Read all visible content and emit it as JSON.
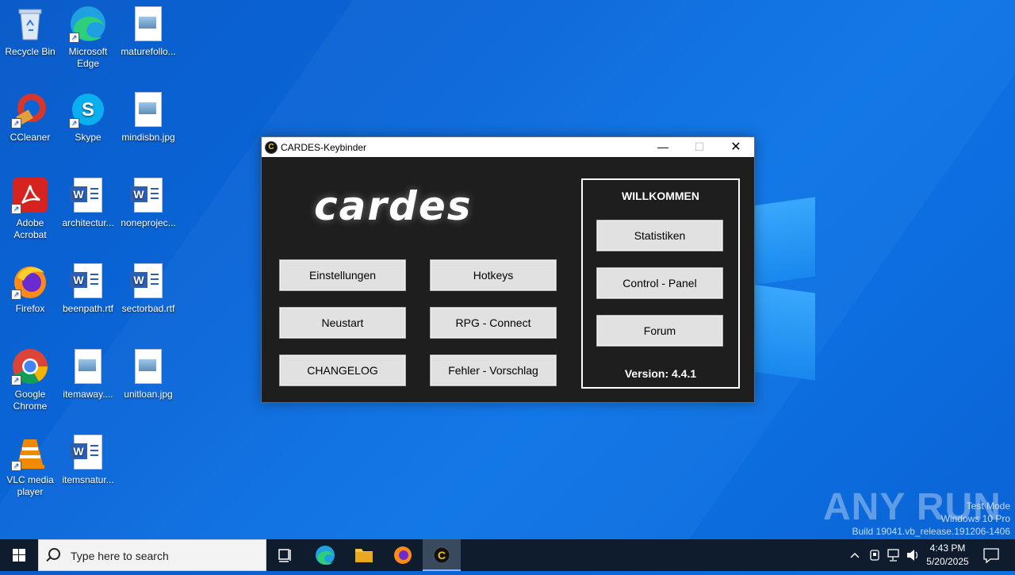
{
  "desktop": {
    "icons": [
      {
        "label": "Recycle Bin",
        "icon": "recycle-bin-icon"
      },
      {
        "label": "Microsoft Edge",
        "icon": "edge-icon"
      },
      {
        "label": "maturefollo...",
        "icon": "image-file-icon"
      },
      {
        "label": "CCleaner",
        "icon": "ccleaner-icon"
      },
      {
        "label": "Skype",
        "icon": "skype-icon"
      },
      {
        "label": "mindisbn.jpg",
        "icon": "image-file-icon"
      },
      {
        "label": "Adobe Acrobat",
        "icon": "acrobat-icon"
      },
      {
        "label": "architectur...",
        "icon": "word-document-icon"
      },
      {
        "label": "noneprojec...",
        "icon": "word-document-icon"
      },
      {
        "label": "Firefox",
        "icon": "firefox-icon"
      },
      {
        "label": "beenpath.rtf",
        "icon": "word-document-icon"
      },
      {
        "label": "sectorbad.rtf",
        "icon": "word-document-icon"
      },
      {
        "label": "Google Chrome",
        "icon": "chrome-icon"
      },
      {
        "label": "itemaway....",
        "icon": "image-file-icon"
      },
      {
        "label": "unitloan.jpg",
        "icon": "image-file-icon"
      },
      {
        "label": "VLC media player",
        "icon": "vlc-icon"
      },
      {
        "label": "itemsnatur...",
        "icon": "word-document-icon"
      }
    ]
  },
  "app": {
    "title": "CARDES-Keybinder",
    "logo": "cardes",
    "buttons": {
      "einstellungen": "Einstellungen",
      "hotkeys": "Hotkeys",
      "neustart": "Neustart",
      "rpg_connect": "RPG - Connect",
      "changelog": "CHANGELOG",
      "fehler_vorschlag": "Fehler - Vorschlag"
    },
    "panel": {
      "title": "WILLKOMMEN",
      "statistiken": "Statistiken",
      "control_panel": "Control - Panel",
      "forum": "Forum",
      "version": "Version: 4.4.1"
    }
  },
  "watermark": {
    "brand": "ANY RUN",
    "line1": "Test Mode",
    "line2": "Windows 10 Pro",
    "line3": "Build 19041.vb_release.191206-1406"
  },
  "taskbar": {
    "search_placeholder": "Type here to search",
    "time": "4:43 PM",
    "date": "5/20/2025"
  },
  "colors": {
    "desktop_blue": "#0a66d8",
    "app_background": "#1e1e1e",
    "taskbar": "#0f1c2e"
  }
}
